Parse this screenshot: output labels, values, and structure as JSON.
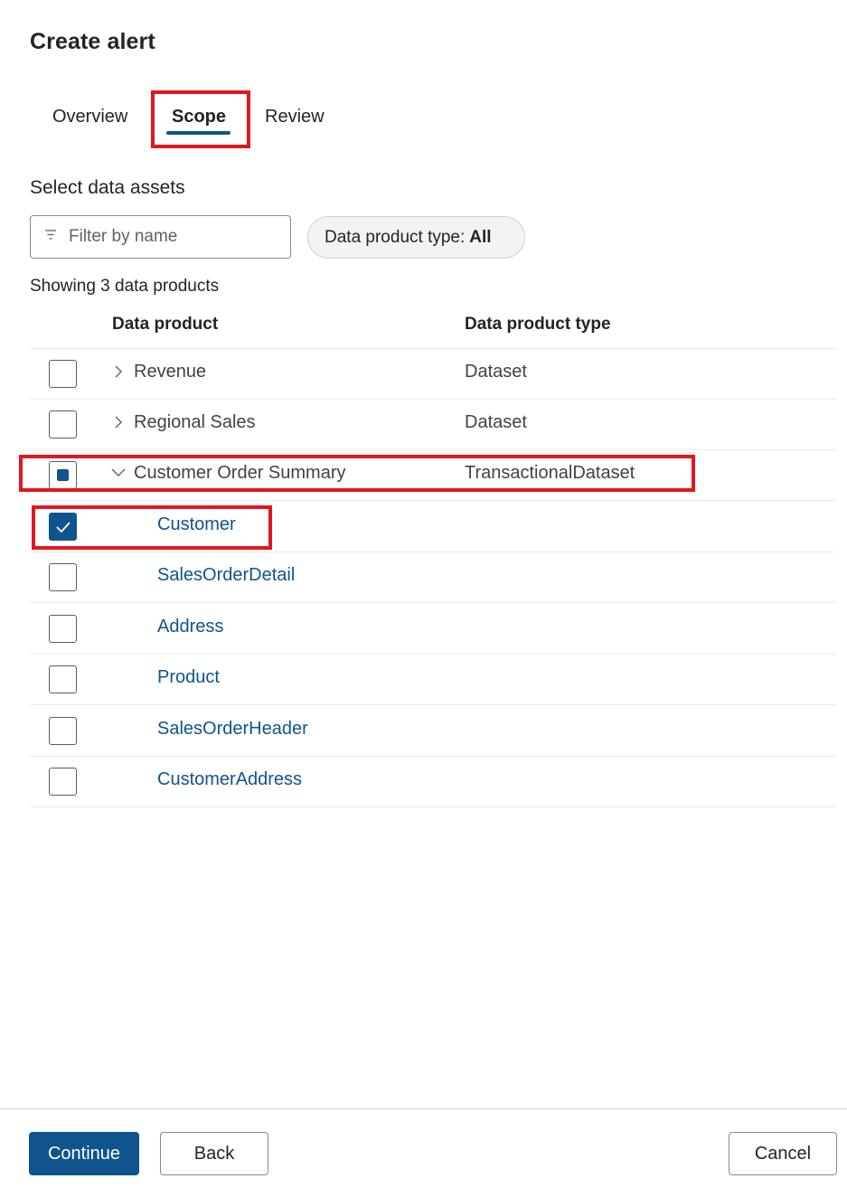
{
  "dialog": {
    "title": "Create alert"
  },
  "tabs": [
    {
      "label": "Overview",
      "selected": false
    },
    {
      "label": "Scope",
      "selected": true
    },
    {
      "label": "Review",
      "selected": false
    }
  ],
  "scope": {
    "section_label": "Select data assets",
    "filter": {
      "placeholder": "Filter by name",
      "value": "",
      "icon": "filter-icon"
    },
    "type_filter": {
      "label": "Data product type:",
      "value": "All"
    },
    "count_label": "Showing 3 data products"
  },
  "table": {
    "columns": [
      "Data product",
      "Data product type"
    ],
    "products": [
      {
        "name": "Revenue",
        "type": "Dataset",
        "expanded": false,
        "checked": "unchecked"
      },
      {
        "name": "Regional Sales",
        "type": "Dataset",
        "expanded": false,
        "checked": "unchecked"
      },
      {
        "name": "Customer Order Summary",
        "type": "TransactionalDataset",
        "expanded": true,
        "checked": "mixed"
      }
    ],
    "assets": [
      {
        "name": "Customer",
        "checked": true
      },
      {
        "name": "SalesOrderDetail",
        "checked": false
      },
      {
        "name": "Address",
        "checked": false
      },
      {
        "name": "Product",
        "checked": false
      },
      {
        "name": "SalesOrderHeader",
        "checked": false
      },
      {
        "name": "CustomerAddress",
        "checked": false
      }
    ]
  },
  "footer": {
    "continue_label": "Continue",
    "back_label": "Back",
    "cancel_label": "Cancel"
  },
  "colors": {
    "accent": "#0f548c",
    "highlight": "#e3161e"
  }
}
